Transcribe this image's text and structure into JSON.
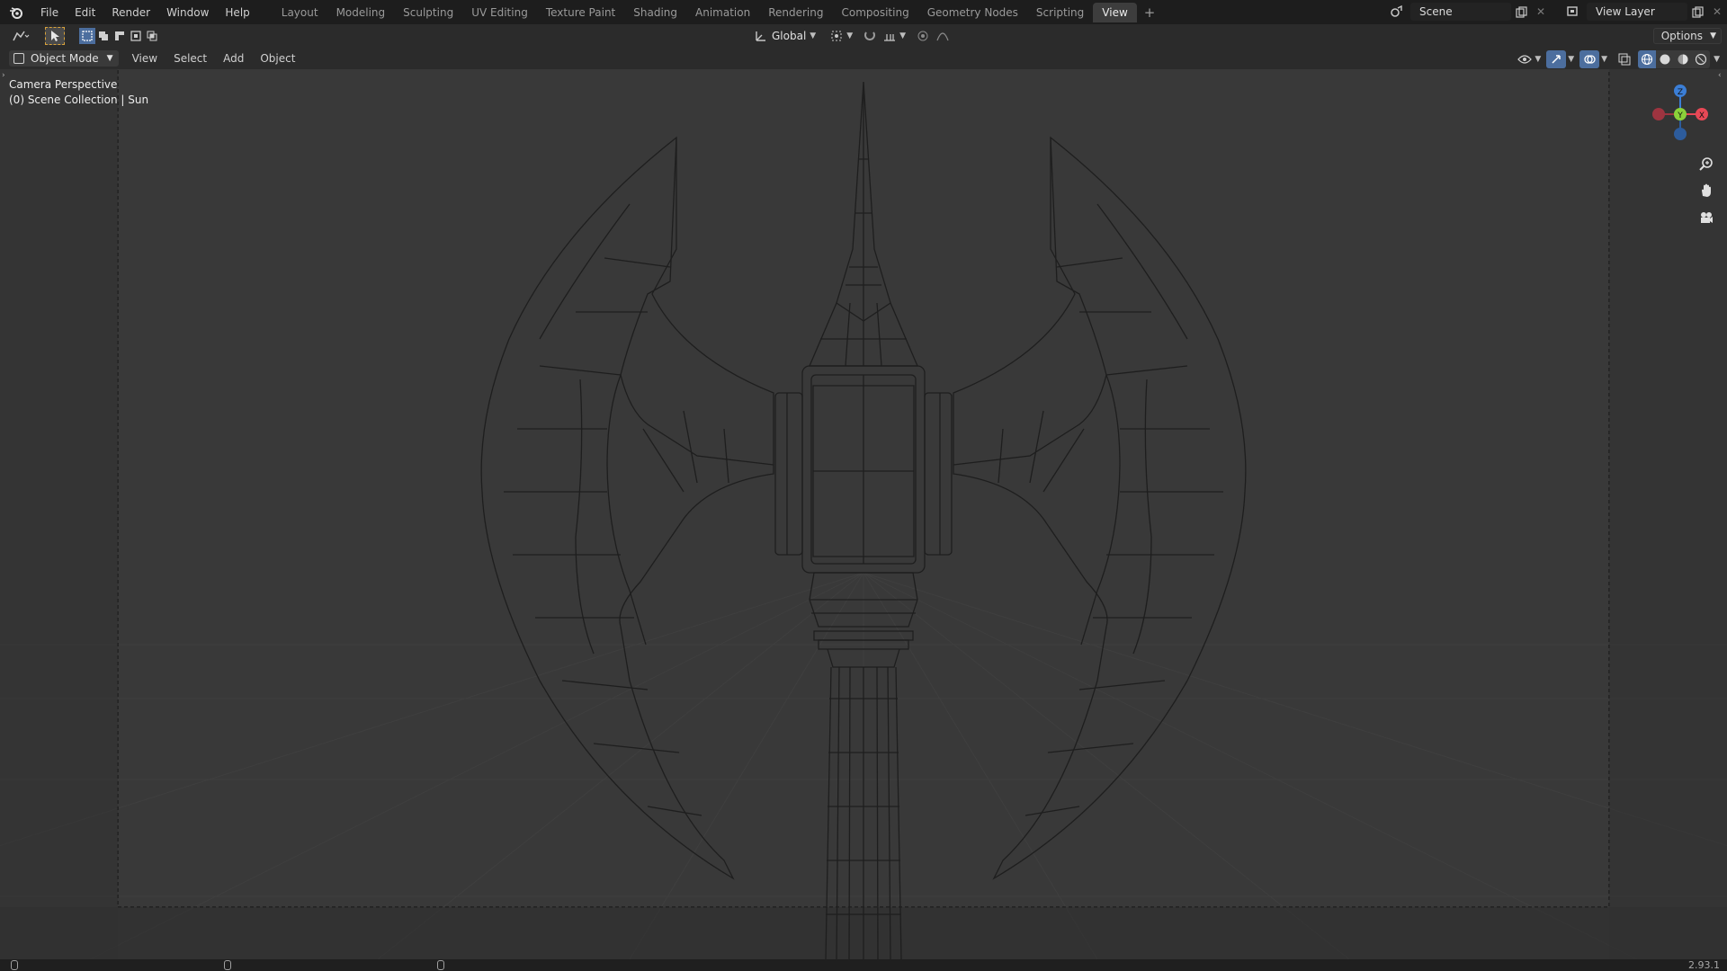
{
  "topbar": {
    "menus": [
      "File",
      "Edit",
      "Render",
      "Window",
      "Help"
    ],
    "workspace_tabs": [
      "Layout",
      "Modeling",
      "Sculpting",
      "UV Editing",
      "Texture Paint",
      "Shading",
      "Animation",
      "Rendering",
      "Compositing",
      "Geometry Nodes",
      "Scripting",
      "View"
    ],
    "active_tab": "View",
    "add_tab": "+",
    "scene_value": "Scene",
    "view_layer_value": "View Layer"
  },
  "tool_header": {
    "transform_orientation": "Global",
    "options_label": "Options"
  },
  "viewport_header": {
    "mode": "Object Mode",
    "menus": [
      "View",
      "Select",
      "Add",
      "Object"
    ]
  },
  "viewport": {
    "camera_label": "Camera Perspective",
    "collection_label": "(0) Scene Collection | Sun",
    "gizmo_axes": {
      "x": "X",
      "y": "Y",
      "z": "Z"
    }
  },
  "statusbar": {
    "version": "2.93.1"
  },
  "colors": {
    "axis_x": "#e84856",
    "axis_y": "#8bd13a",
    "axis_z": "#3b7ed6",
    "active_tab_bg": "#3d3d3d",
    "viewport_bg": "#393939"
  }
}
